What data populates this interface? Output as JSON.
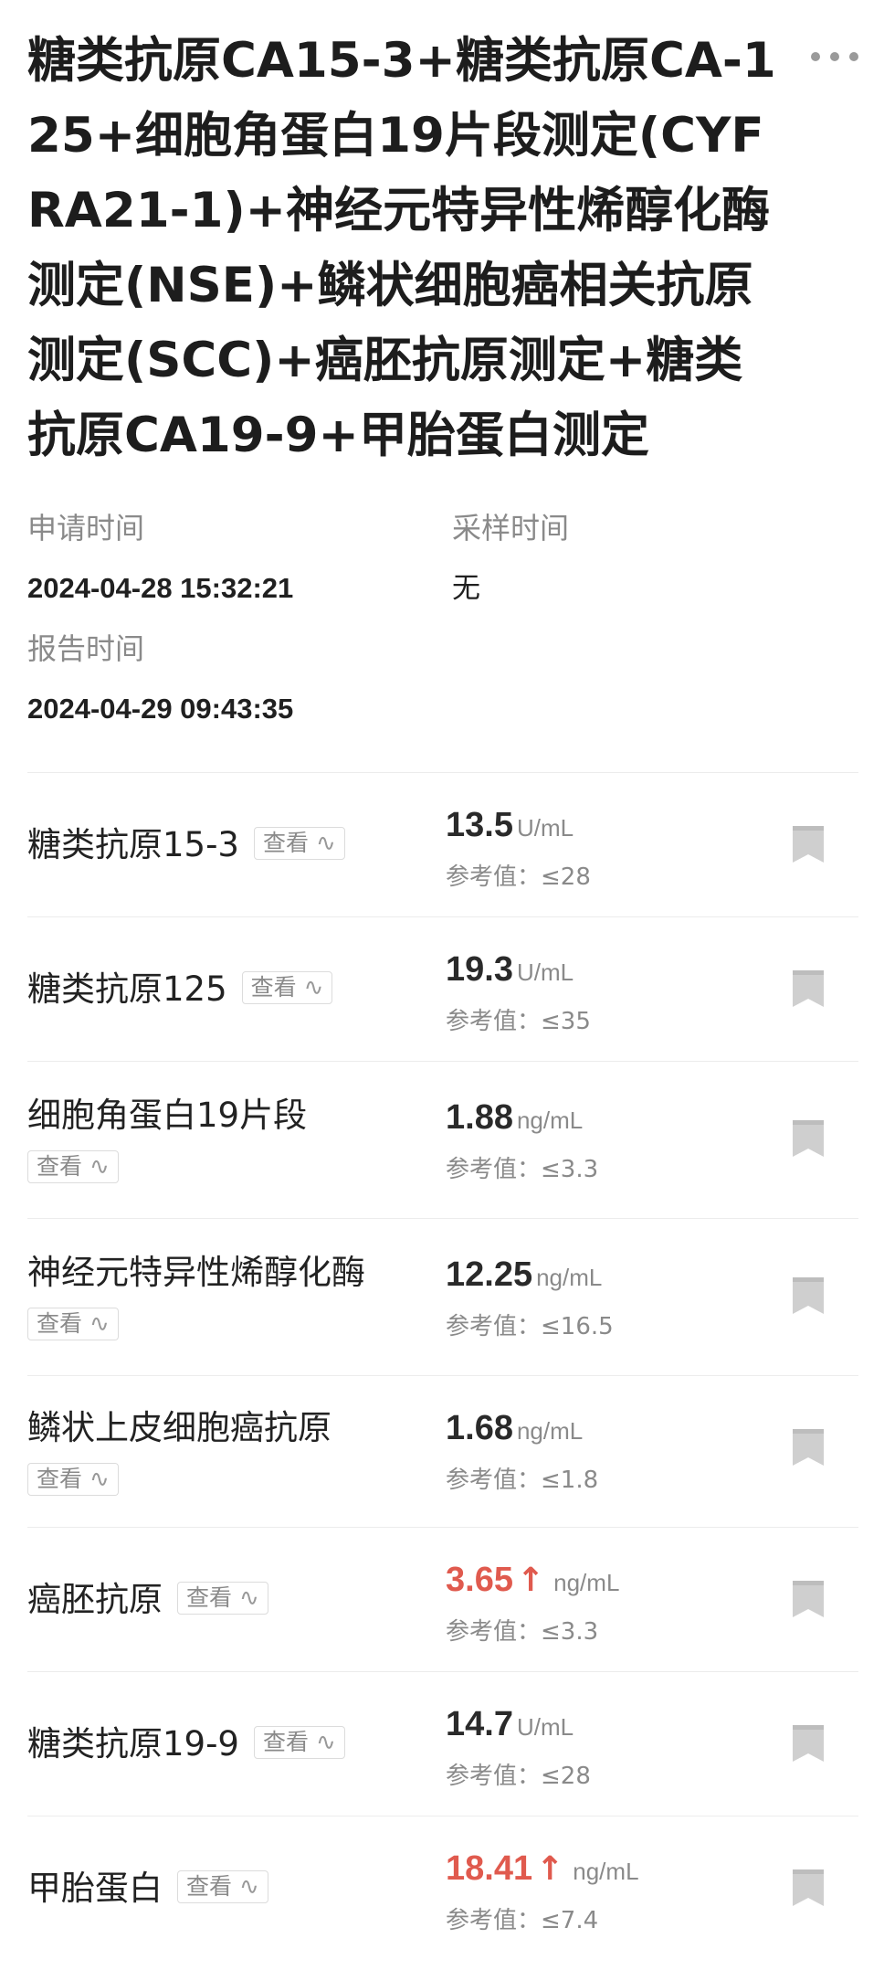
{
  "header": {
    "title": "糖类抗原CA15-3+糖类抗原CA-125+细胞角蛋白19片段测定(CYFRA21-1)+神经元特异性烯醇化酶测定(NSE)+鳞状细胞癌相关抗原测定(SCC)+癌胚抗原测定+糖类抗原CA19-9+甲胎蛋白测定",
    "more_icon": "more-dots-icon"
  },
  "meta": {
    "apply_label": "申请时间",
    "apply_value": "2024-04-28 15:32:21",
    "sample_label": "采样时间",
    "sample_value": "无",
    "report_label": "报告时间",
    "report_value": "2024-04-29 09:43:35"
  },
  "items": [
    {
      "name": "糖类抗原15-3",
      "view": "查看",
      "value": "13.5",
      "unit": "U/mL",
      "ref": "参考值：≤28",
      "high": false
    },
    {
      "name": "糖类抗原125",
      "view": "查看",
      "value": "19.3",
      "unit": "U/mL",
      "ref": "参考值：≤35",
      "high": false
    },
    {
      "name": "细胞角蛋白19片段",
      "view": "查看",
      "value": "1.88",
      "unit": "ng/mL",
      "ref": "参考值：≤3.3",
      "high": false
    },
    {
      "name": "神经元特异性烯醇化酶",
      "view": "查看",
      "value": "12.25",
      "unit": "ng/mL",
      "ref": "参考值：≤16.5",
      "high": false
    },
    {
      "name": "鳞状上皮细胞癌抗原",
      "view": "查看",
      "value": "1.68",
      "unit": "ng/mL",
      "ref": "参考值：≤1.8",
      "high": false
    },
    {
      "name": "癌胚抗原",
      "view": "查看",
      "value": "3.65",
      "unit": "ng/mL",
      "ref": "参考值：≤3.3",
      "high": true
    },
    {
      "name": "糖类抗原19-9",
      "view": "查看",
      "value": "14.7",
      "unit": "U/mL",
      "ref": "参考值：≤28",
      "high": false
    },
    {
      "name": "甲胎蛋白",
      "view": "查看",
      "value": "18.41",
      "unit": "ng/mL",
      "ref": "参考值：≤7.4",
      "high": true
    }
  ],
  "colors": {
    "high": "#e05a4e",
    "muted": "#8a8a8a",
    "bookmark": "#cfcfcf"
  },
  "icons": {
    "trend": "trend-wave-icon",
    "up_arrow": "up-arrow-icon",
    "bookmark": "bookmark-icon"
  }
}
